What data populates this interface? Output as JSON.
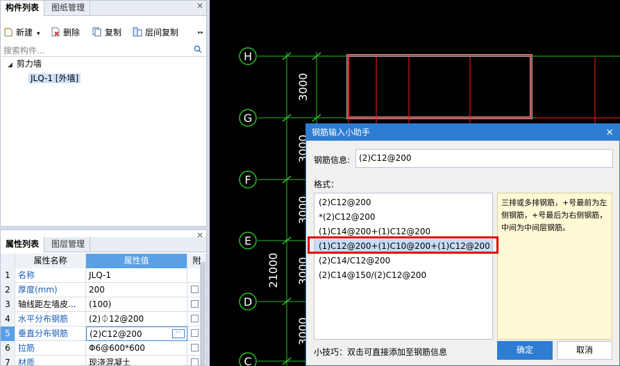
{
  "top_panel": {
    "tabs": [
      "构件列表",
      "图纸管理"
    ],
    "toolbar": {
      "new_label": "新建",
      "delete_label": "删除",
      "copy_label": "复制",
      "floor_copy_label": "层间复制",
      "more": "▸▸"
    },
    "search_placeholder": "搜索构件...",
    "tree": {
      "group": "剪力墙",
      "item": "JLQ-1 [外墙]"
    }
  },
  "bottom_panel": {
    "tabs": [
      "属性列表",
      "图层管理"
    ],
    "columns": {
      "name": "属性名称",
      "value": "属性值",
      "attach": "附"
    },
    "rows": [
      {
        "num": "1",
        "name": "名称",
        "value": "JLQ-1",
        "blue": true,
        "checkbox": false
      },
      {
        "num": "2",
        "name": "厚度(mm)",
        "value": "200",
        "blue": true,
        "checkbox": true
      },
      {
        "num": "3",
        "name": "轴线距左墙皮...",
        "value": "(100)",
        "blue": false,
        "checkbox": true
      },
      {
        "num": "4",
        "name": "水平分布钢筋",
        "value": "(2)⏀12@200",
        "blue": true,
        "checkbox": true
      },
      {
        "num": "5",
        "name": "垂直分布钢筋",
        "value": "(2)C12@200",
        "blue": true,
        "checkbox": true
      },
      {
        "num": "6",
        "name": "拉筋",
        "value": "Φ6@600*600",
        "blue": true,
        "checkbox": true
      },
      {
        "num": "7",
        "name": "材质",
        "value": "现浇混凝土",
        "blue": true,
        "checkbox": true
      }
    ],
    "edit_button": "···"
  },
  "canvas": {
    "axes": [
      "H",
      "G",
      "F",
      "E",
      "D",
      "C"
    ],
    "dims": [
      "3000",
      "3000",
      "3000",
      "3000",
      "3000"
    ],
    "total_dim": "21000"
  },
  "dialog": {
    "title": "钢筋输入小助手",
    "close": "×",
    "info_label": "钢筋信息:",
    "info_value": "(2)C12@200",
    "format_label": "格式：",
    "formats": [
      "(2)C12@200",
      "*(2)C12@200",
      "(1)C14@200+(1)C12@200",
      "(1)C12@200+(1)C10@200+(1)C12@200",
      "(2)C14/C12@200",
      "(2)C14@150/(2)C12@200"
    ],
    "selected_index": 3,
    "hint": "三排或多排钢筋，+号最前为左侧钢筋，+号最后为右侧钢筋，中间为中间层钢筋。",
    "tip": "小技巧：双击可直接添加至钢筋信息",
    "ok": "确定",
    "cancel": "取消"
  },
  "colors": {
    "accent": "#2d7dd2",
    "highlight": "#e00000",
    "grid_green": "#2bbf2b",
    "wall_red": "#e01818"
  }
}
